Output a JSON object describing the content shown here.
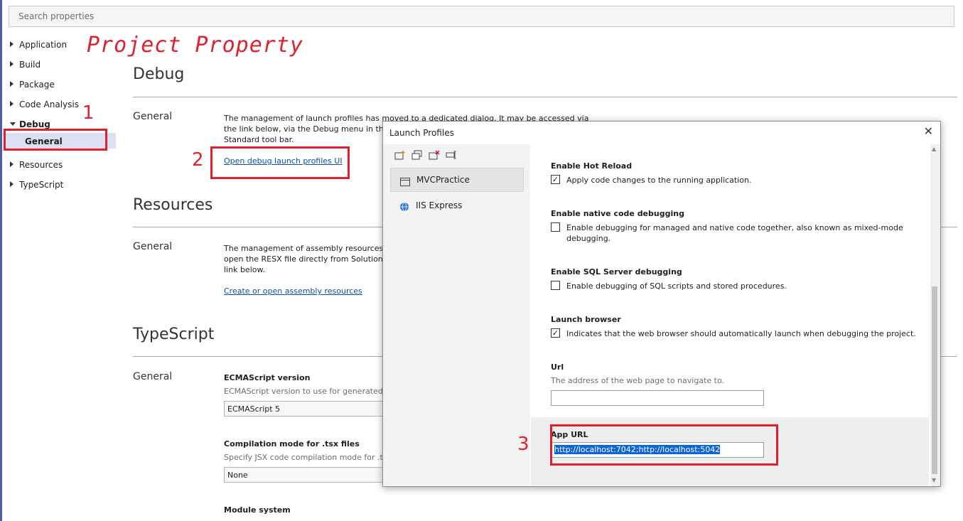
{
  "search": {
    "placeholder": "Search properties"
  },
  "nav": {
    "items": [
      {
        "label": "Application"
      },
      {
        "label": "Build"
      },
      {
        "label": "Package"
      },
      {
        "label": "Code Analysis"
      },
      {
        "label": "Debug"
      },
      {
        "label": "General"
      },
      {
        "label": "Resources"
      },
      {
        "label": "TypeScript"
      }
    ]
  },
  "annotations": {
    "title": "Project Property",
    "n1": "1",
    "n2": "2",
    "n3": "3"
  },
  "debug": {
    "title": "Debug",
    "group": "General",
    "desc1": "The management of launch profiles has moved to a dedicated dialog. It may be accessed via",
    "desc2": "the link below, via the Debug menu in the",
    "desc3": "Standard tool bar.",
    "link": "Open debug launch profiles UI"
  },
  "resources": {
    "title": "Resources",
    "group": "General",
    "desc1": "The management of assembly resources n",
    "desc2": "open the RESX file directly from Solution E",
    "desc3": "link below.",
    "link": "Create or open assembly resources"
  },
  "typescript": {
    "title": "TypeScript",
    "group": "General",
    "ecma_label": "ECMAScript version",
    "ecma_desc": "ECMAScript version to use for generated Ja",
    "ecma_value": "ECMAScript 5",
    "tsx_label": "Compilation mode for .tsx files",
    "tsx_desc": "Specify JSX code compilation mode for .tsx",
    "tsx_value": "None",
    "module_label": "Module system"
  },
  "dialog": {
    "title": "Launch Profiles",
    "close": "✕",
    "profiles": [
      {
        "label": "MVCPractice"
      },
      {
        "label": "IIS Express"
      }
    ],
    "hot_reload": {
      "label": "Enable Hot Reload",
      "text": "Apply code changes to the running application.",
      "checked": true
    },
    "native": {
      "label": "Enable native code debugging",
      "text1": "Enable debugging for managed and native code together, also known as mixed-mode",
      "text2": "debugging.",
      "checked": false
    },
    "sql": {
      "label": "Enable SQL Server debugging",
      "text": "Enable debugging of SQL scripts and stored procedures.",
      "checked": false
    },
    "browser": {
      "label": "Launch browser",
      "text": "Indicates that the web browser should automatically launch when debugging the project.",
      "checked": true
    },
    "url": {
      "label": "Url",
      "desc": "The address of the web page to navigate to.",
      "value": ""
    },
    "app_url": {
      "label": "App URL",
      "value": "http://localhost:7042;http://localhost:5042"
    }
  },
  "colors": {
    "accent_red": "#e0202e",
    "link_blue": "#0e4fa6",
    "selection_blue": "#0a64d6"
  }
}
